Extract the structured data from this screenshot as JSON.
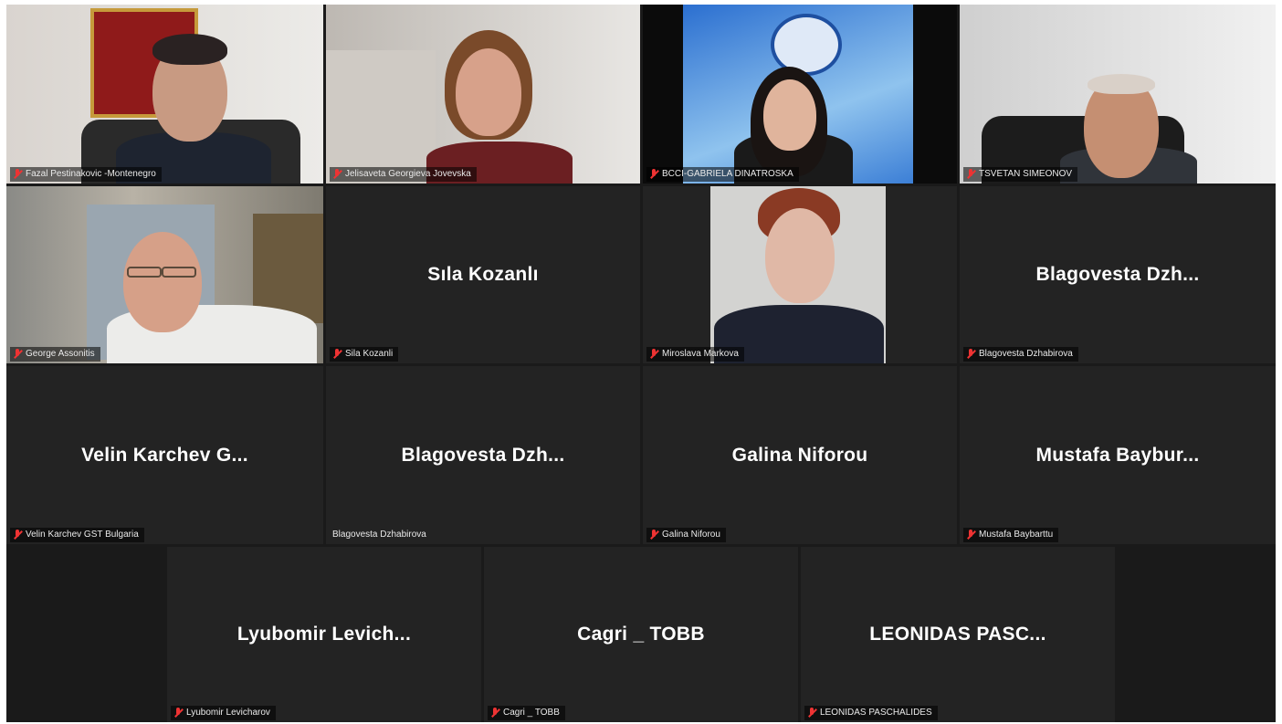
{
  "participants": [
    {
      "label": "Fazal Pestinakovic -Montenegro",
      "name": "",
      "video": true
    },
    {
      "label": "Jelisaveta Georgieva Jovevska",
      "name": "",
      "video": true
    },
    {
      "label": "BCCI-GABRIELA DINATROSKA",
      "name": "",
      "video": true
    },
    {
      "label": "TSVETAN SIMEONOV",
      "name": "",
      "video": true
    },
    {
      "label": "George Assonitis",
      "name": "",
      "video": true
    },
    {
      "label": "Sila Kozanli",
      "name": "Sıla Kozanlı",
      "video": false
    },
    {
      "label": "Miroslava Markova",
      "name": "",
      "video": true
    },
    {
      "label": "Blagovesta Dzhabirova",
      "name": "Blagovesta  Dzh...",
      "video": false
    },
    {
      "label": "Velin Karchev GST Bulgaria",
      "name": "Velin  Karchev  G...",
      "video": false
    },
    {
      "label": "Blagovesta Dzhabirova",
      "name": "Blagovesta  Dzh...",
      "video": false
    },
    {
      "label": "Galina Niforou",
      "name": "Galina Niforou",
      "video": false
    },
    {
      "label": "Mustafa Baybarttu",
      "name": "Mustafa  Baybur...",
      "video": false
    },
    {
      "label": "Lyubomir Levicharov",
      "name": "Lyubomir  Levich...",
      "video": false
    },
    {
      "label": "Cagri _ TOBB",
      "name": "Cagri _ TOBB",
      "video": false
    },
    {
      "label": "LEONIDAS PASCHALIDES",
      "name": "LEONIDAS  PASC...",
      "video": false
    }
  ],
  "colors": {
    "active_speaker_border": "#b9d62c",
    "tile_bg": "#232323",
    "muted_icon": "#e33333"
  },
  "icons": {
    "muted": "microphone-muted-icon"
  }
}
